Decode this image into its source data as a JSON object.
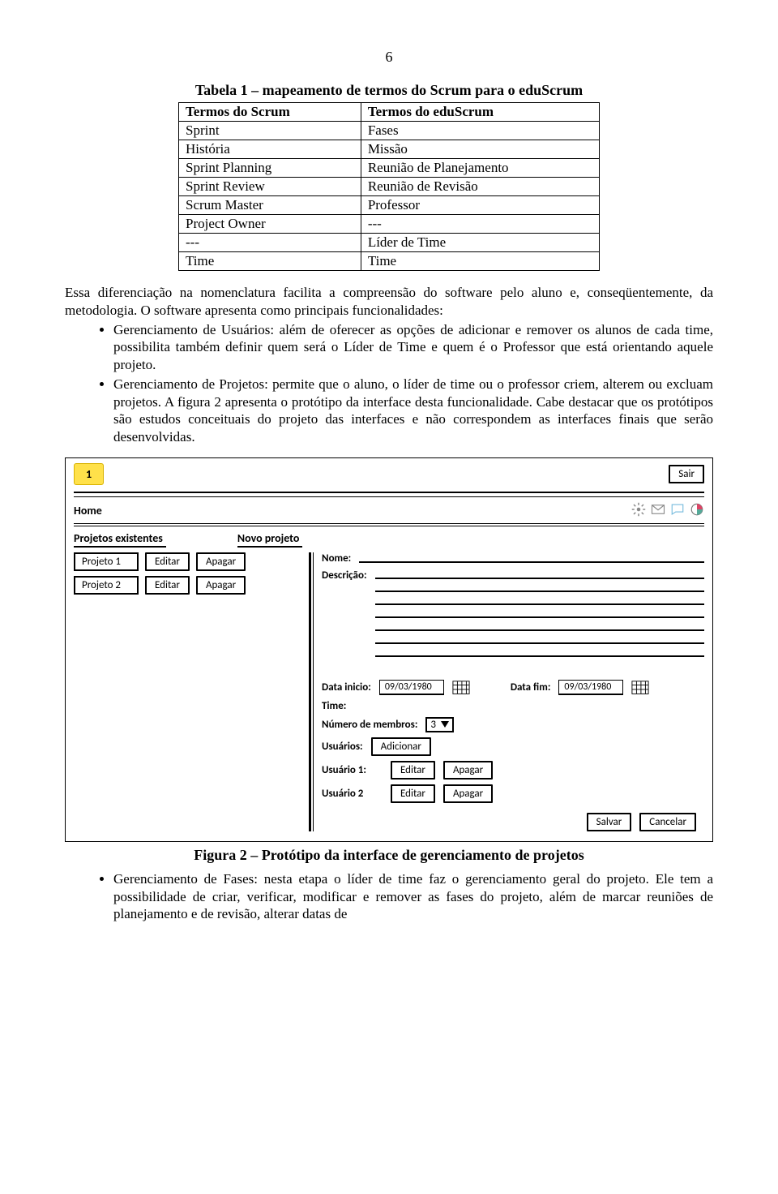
{
  "page_number": "6",
  "table": {
    "caption": "Tabela 1 – mapeamento de termos do Scrum para o eduScrum",
    "head": {
      "c1": "Termos do Scrum",
      "c2": "Termos do eduScrum"
    },
    "rows": [
      {
        "c1": "Sprint",
        "c2": "Fases"
      },
      {
        "c1": "História",
        "c2": "Missão"
      },
      {
        "c1": "Sprint Planning",
        "c2": "Reunião de Planejamento"
      },
      {
        "c1": "Sprint Review",
        "c2": "Reunião de Revisão"
      },
      {
        "c1": "Scrum Master",
        "c2": "Professor"
      },
      {
        "c1": "Project Owner",
        "c2": "---"
      },
      {
        "c1": "---",
        "c2": "Líder de Time"
      },
      {
        "c1": "Time",
        "c2": "Time"
      }
    ]
  },
  "para_intro": "Essa diferenciação na nomenclatura facilita a compreensão do software pelo aluno e, conseqüentemente, da metodologia. O software apresenta como principais funcionalidades:",
  "bullets_top": [
    "Gerenciamento de Usuários: além de oferecer as opções de adicionar e remover os alunos de cada time, possibilita também definir quem será o Líder de Time e quem é o Professor que está orientando aquele projeto.",
    "Gerenciamento de Projetos: permite que o aluno, o líder de time ou o professor criem, alterem ou excluam projetos. A figura 2 apresenta o protótipo da interface desta funcionalidade. Cabe destacar que os protótipos são estudos conceituais do projeto das interfaces e não correspondem as interfaces finais que serão desenvolvidas."
  ],
  "proto": {
    "badge": "1",
    "sair": "Sair",
    "home": "Home",
    "left_title": "Projetos existentes",
    "right_title": "Novo projeto",
    "projects": [
      {
        "name": "Projeto 1",
        "edit": "Editar",
        "del": "Apagar"
      },
      {
        "name": "Projeto 2",
        "edit": "Editar",
        "del": "Apagar"
      }
    ],
    "form": {
      "nome": "Nome:",
      "descricao": "Descrição:",
      "data_inicio_lbl": "Data inicio:",
      "data_inicio_val": "09/03/1980",
      "data_fim_lbl": "Data fim:",
      "data_fim_val": "09/03/1980",
      "time": "Time:",
      "num_membros_lbl": "Número de membros:",
      "num_membros_val": "3",
      "usuarios_lbl": "Usuários:",
      "adicionar": "Adicionar",
      "users": [
        {
          "name": "Usuário 1:",
          "edit": "Editar",
          "del": "Apagar"
        },
        {
          "name": "Usuário 2",
          "edit": "Editar",
          "del": "Apagar"
        }
      ],
      "salvar": "Salvar",
      "cancelar": "Cancelar"
    }
  },
  "fig_caption": "Figura 2 – Protótipo da interface de gerenciamento de projetos",
  "bullets_bottom": [
    "Gerenciamento de Fases: nesta etapa o líder de time faz o gerenciamento geral do projeto. Ele tem a possibilidade de criar, verificar, modificar e remover as fases do projeto, além de marcar reuniões de planejamento e de revisão, alterar datas de"
  ]
}
